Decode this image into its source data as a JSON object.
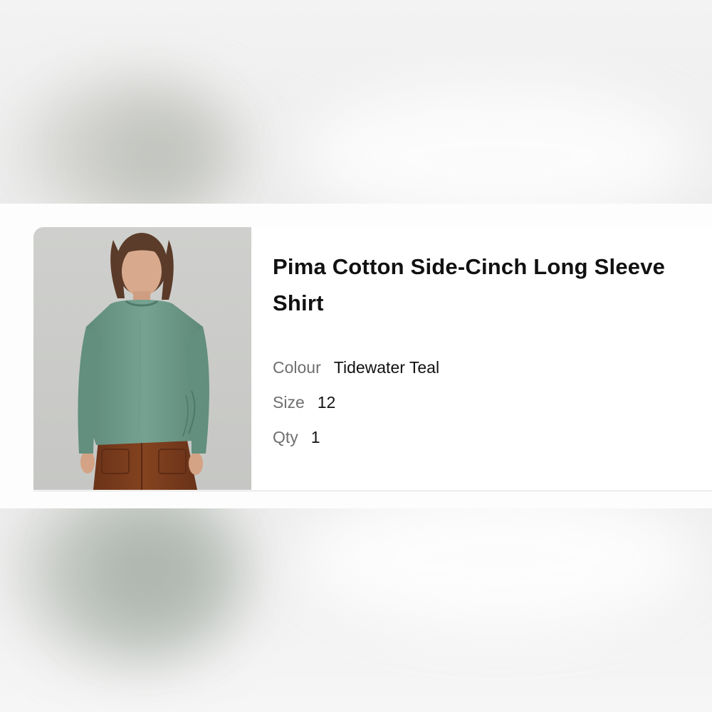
{
  "product": {
    "title": "Pima Cotton Side-Cinch Long Sleeve Shirt",
    "image": {
      "icon": "product-photo-model-wearing-teal-long-sleeve-shirt",
      "shirt_color": "#6e9b8a",
      "pants_color": "#7a3e22",
      "background_color": "#cbcccb"
    },
    "attributes": [
      {
        "label": "Colour",
        "value": "Tidewater Teal"
      },
      {
        "label": "Size",
        "value": "12"
      },
      {
        "label": "Qty",
        "value": "1"
      }
    ]
  }
}
